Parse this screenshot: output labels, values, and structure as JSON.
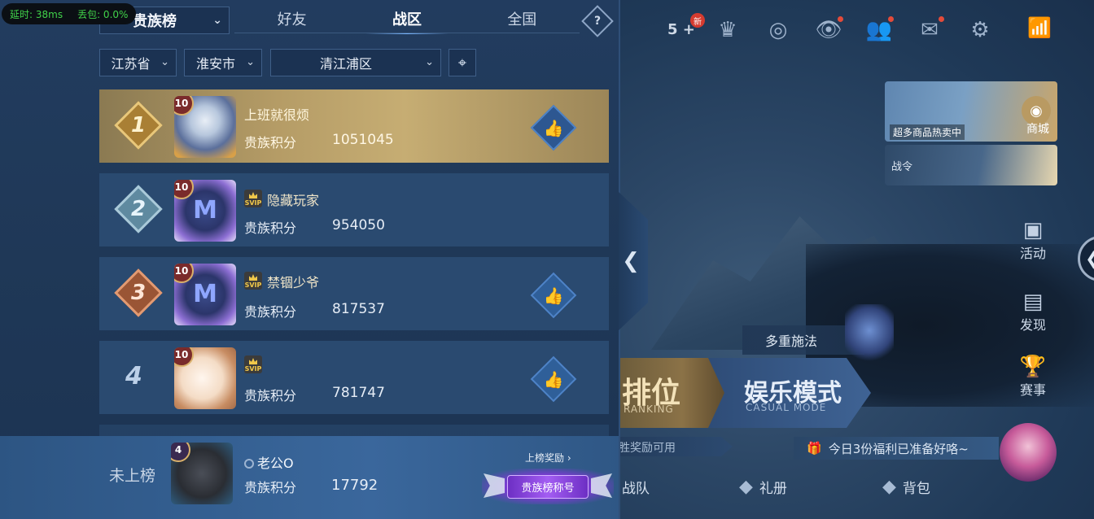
{
  "status": {
    "latency": "延时: 38ms",
    "packet_loss": "丢包: 0.0%"
  },
  "leaderboard": {
    "type": "贵族榜",
    "tabs": [
      {
        "label": "好友",
        "active": false
      },
      {
        "label": "战区",
        "active": true
      },
      {
        "label": "全国",
        "active": false
      }
    ],
    "help_icon": "?",
    "region": {
      "province": "江苏省",
      "city": "淮安市",
      "district": "清江浦区"
    },
    "entries": [
      {
        "rank": "1",
        "name": "上班就很烦",
        "level": "10",
        "svip": false,
        "score_label": "贵族积分",
        "score": "1051045",
        "liked": true
      },
      {
        "rank": "2",
        "name": "隐藏玩家",
        "level": "10",
        "svip": true,
        "score_label": "贵族积分",
        "score": "954050",
        "liked": false
      },
      {
        "rank": "3",
        "name": "禁锢少爷",
        "level": "10",
        "svip": true,
        "score_label": "贵族积分",
        "score": "817537",
        "liked": true
      },
      {
        "rank": "4",
        "name": "",
        "level": "10",
        "svip": true,
        "score_label": "贵族积分",
        "score": "781747",
        "liked": true
      }
    ],
    "svip_text": "SVIP",
    "me": {
      "status": "未上榜",
      "level": "4",
      "name": "老公O",
      "score_label": "贵族积分",
      "score": "17792",
      "reward_link": "上榜奖励 ›",
      "title_badge": "贵族榜称号"
    }
  },
  "lobby": {
    "friend_count": "5",
    "new_badge": "新",
    "shop_caption": "超多商品热卖中",
    "shop_label": "商城",
    "battlepass_label": "战令",
    "side_buttons": [
      "活动",
      "发现",
      "赛事"
    ],
    "mode_multi": "多重施法",
    "ranked": {
      "title": "排位",
      "subtitle": "RANKING"
    },
    "casual": {
      "title": "娱乐模式",
      "subtitle": "CASUAL MODE"
    },
    "win_reward": "胜奖励可用",
    "gift_notice": "今日3份福利已准备好咯~",
    "nav": [
      "战队",
      "礼册",
      "背包"
    ]
  },
  "colors": {
    "gold_row": "#b59c66",
    "panel": "#1f3857",
    "accent_blue": "#79b6ff",
    "purple_badge": "#a35df2"
  },
  "icons": [
    "location-pin-icon",
    "thumbs-up-icon",
    "settings-gear-icon",
    "mail-icon",
    "friends-icon",
    "eye-icon",
    "wifi-icon",
    "trophy-icon",
    "calendar-icon",
    "gift-icon",
    "chevron-left-icon"
  ]
}
